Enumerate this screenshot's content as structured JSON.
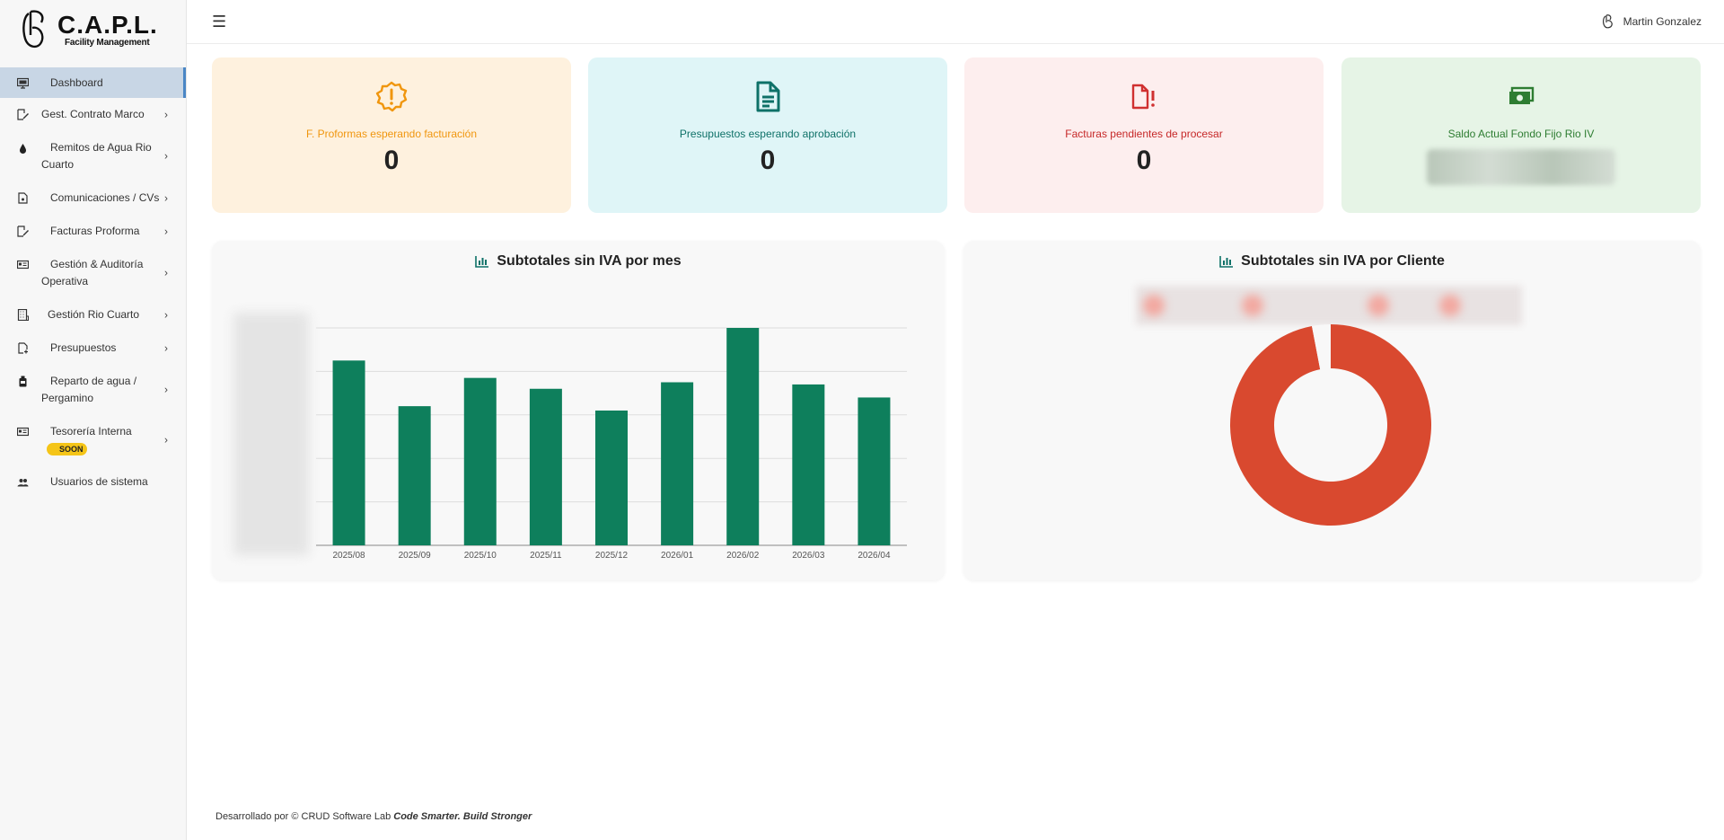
{
  "brand": {
    "title": "C.A.P.L.",
    "subtitle": "Facility Management"
  },
  "sidebar": {
    "items": [
      {
        "label": "Dashboard",
        "icon": "monitor-icon",
        "active": true,
        "chevron": false
      },
      {
        "label": "Gest. Contrato Marco",
        "icon": "edit-doc-icon",
        "chevron": true
      },
      {
        "label": "Remitos de Agua Rio Cuarto",
        "icon": "water-drop-icon",
        "chevron": true
      },
      {
        "label": "Comunicaciones / CVs",
        "icon": "file-icon",
        "chevron": true
      },
      {
        "label": "Facturas Proforma",
        "icon": "edit-doc-icon",
        "chevron": true
      },
      {
        "label": "Gestión & Auditoría Operativa",
        "icon": "id-card-icon",
        "chevron": true
      },
      {
        "label": "Gestión Rio Cuarto",
        "icon": "building-icon",
        "chevron": true
      },
      {
        "label": "Presupuestos",
        "icon": "file-plus-icon",
        "chevron": true
      },
      {
        "label": "Reparto de agua / Pergamino",
        "icon": "water-bottle-icon",
        "chevron": true
      },
      {
        "label": "Tesorería Interna",
        "icon": "money-icon",
        "chevron": true,
        "badge": "SOON"
      },
      {
        "label": "Usuarios de sistema",
        "icon": "users-icon",
        "chevron": false
      }
    ]
  },
  "topbar": {
    "menu_icon": "hamburger-icon",
    "user_name": "Martin Gonzalez"
  },
  "cards": [
    {
      "label": "F. Proformas esperando facturación",
      "value": "0",
      "bg": "#fef1de",
      "color": "#f0960e",
      "icon": "alert-badge-icon"
    },
    {
      "label": "Presupuestos esperando aprobación",
      "value": "0",
      "bg": "#dff5f7",
      "color": "#0e7168",
      "icon": "document-icon"
    },
    {
      "label": "Facturas pendientes de procesar",
      "value": "0",
      "bg": "#fdeeee",
      "color": "#c62828",
      "icon": "file-alert-icon"
    },
    {
      "label": "Saldo Actual Fondo Fijo Rio IV",
      "value": "",
      "bg": "#e6f4e6",
      "color": "#2e7d32",
      "icon": "money-bill-icon"
    }
  ],
  "chart_data": [
    {
      "type": "bar",
      "title": "Subtotales sin IVA por mes",
      "categories": [
        "2025/08",
        "2025/09",
        "2025/10",
        "2025/11",
        "2025/12",
        "2026/01",
        "2026/02",
        "2026/03",
        "2026/04"
      ],
      "values": [
        85,
        64,
        77,
        72,
        62,
        75,
        100,
        74,
        68
      ],
      "ylim": [
        0,
        100
      ],
      "grid": true,
      "color": "#0e7f5c"
    },
    {
      "type": "pie",
      "title": "Subtotales sin IVA por Cliente",
      "donut": true,
      "values": [
        97,
        3
      ],
      "colors": [
        "#d9492f",
        "#f8f8f8"
      ]
    }
  ],
  "footer": {
    "text": "Desarrollado por © CRUD Software Lab",
    "tagline": "Code Smarter. Build Stronger"
  }
}
